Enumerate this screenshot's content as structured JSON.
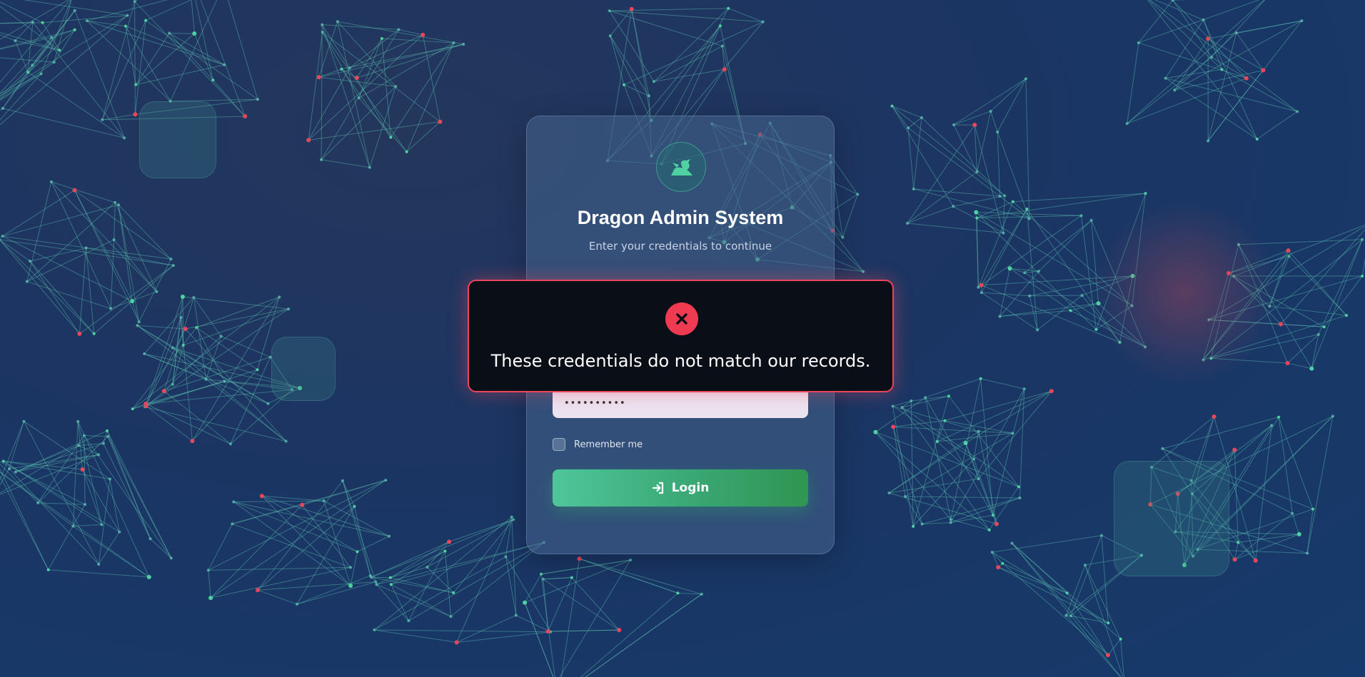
{
  "colors": {
    "accent": "#4fc69a",
    "error": "#ef3b52",
    "background": "#1b3563",
    "node_green": "#4fd1a1",
    "node_red": "#e8475b"
  },
  "login_card": {
    "logo_icon": "dragon-icon",
    "title": "Dragon Admin System",
    "subtitle": "Enter your credentials to continue",
    "username_value": "",
    "password_value": "••••••••••",
    "remember_label": "Remember me",
    "remember_checked": false,
    "login_icon": "sign-in-icon",
    "login_label": "Login"
  },
  "alert": {
    "icon": "close-icon",
    "message": "These credentials do not match our records."
  }
}
